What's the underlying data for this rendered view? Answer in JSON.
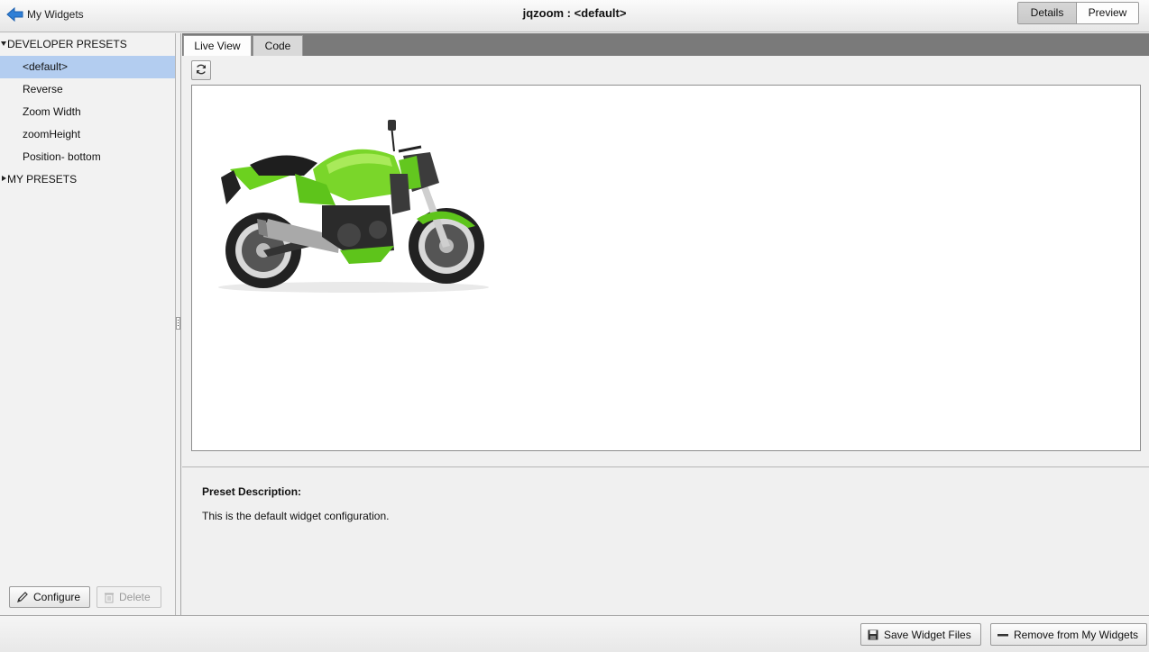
{
  "header": {
    "back_label": "My Widgets",
    "title": "jqzoom : <default>",
    "view_toggle": {
      "details": "Details",
      "preview": "Preview",
      "selected": "Details"
    }
  },
  "sidebar": {
    "developer_presets_label": "DEVELOPER PRESETS",
    "developer_presets": [
      "<default>",
      "Reverse",
      "Zoom Width",
      "zoomHeight",
      "Position- bottom"
    ],
    "selected_preset": "<default>",
    "my_presets_label": "MY PRESETS",
    "configure_label": "Configure",
    "delete_label": "Delete"
  },
  "main": {
    "tabs": [
      "Live View",
      "Code"
    ],
    "active_tab": "Live View",
    "preview_image": "green motorcycle",
    "description_title": "Preset Description:",
    "description_text": "This is the default widget configuration."
  },
  "footer": {
    "save_label": "Save Widget Files",
    "remove_label": "Remove from My Widgets"
  },
  "colors": {
    "selection": "#b3cdf0",
    "tabbar": "#7a7a7a",
    "back_arrow": "#2f7fd6"
  }
}
